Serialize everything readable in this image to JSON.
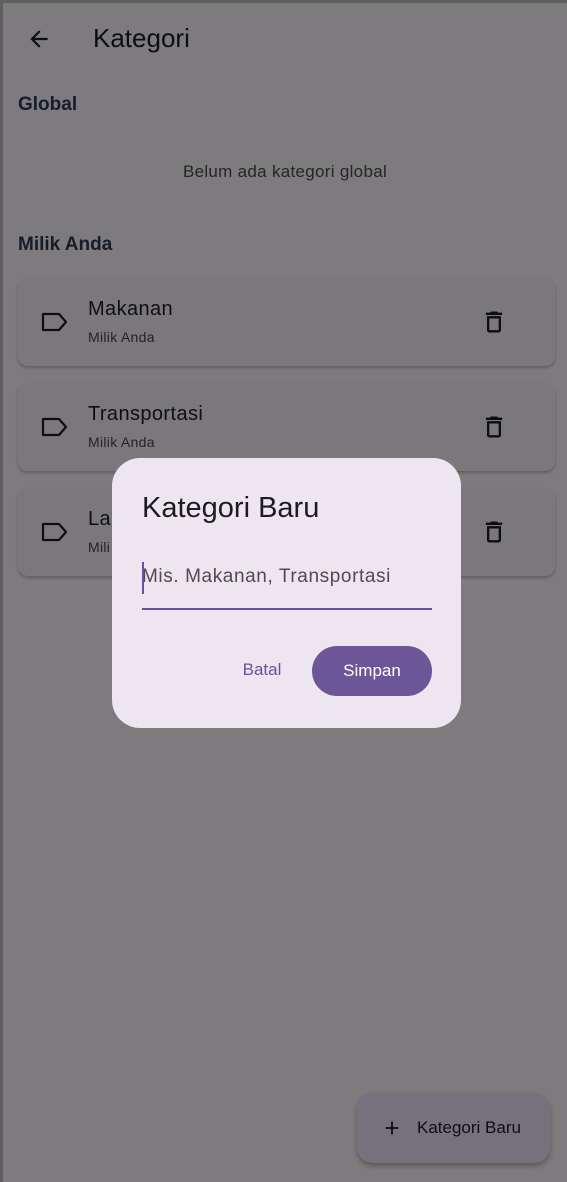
{
  "appbar": {
    "title": "Kategori",
    "back_icon": "arrow-left-icon"
  },
  "sections": {
    "global": {
      "title": "Global",
      "empty_text": "Belum ada kategori global"
    },
    "mine": {
      "title": "Milik Anda"
    }
  },
  "categories": [
    {
      "name": "Makanan",
      "owner": "Milik Anda"
    },
    {
      "name": "Transportasi",
      "owner": "Milik Anda"
    },
    {
      "name": "La",
      "owner": "Mili"
    }
  ],
  "fab": {
    "label": "Kategori Baru",
    "icon": "plus-icon"
  },
  "dialog": {
    "title": "Kategori Baru",
    "input_placeholder": "Mis. Makanan, Transportasi",
    "input_value": "",
    "cancel_label": "Batal",
    "save_label": "Simpan"
  },
  "colors": {
    "primary": "#6750a4",
    "surface": "#fdf7fd",
    "dialog": "#ede5ef",
    "scrim": "rgba(0,0,0,0.5)"
  }
}
